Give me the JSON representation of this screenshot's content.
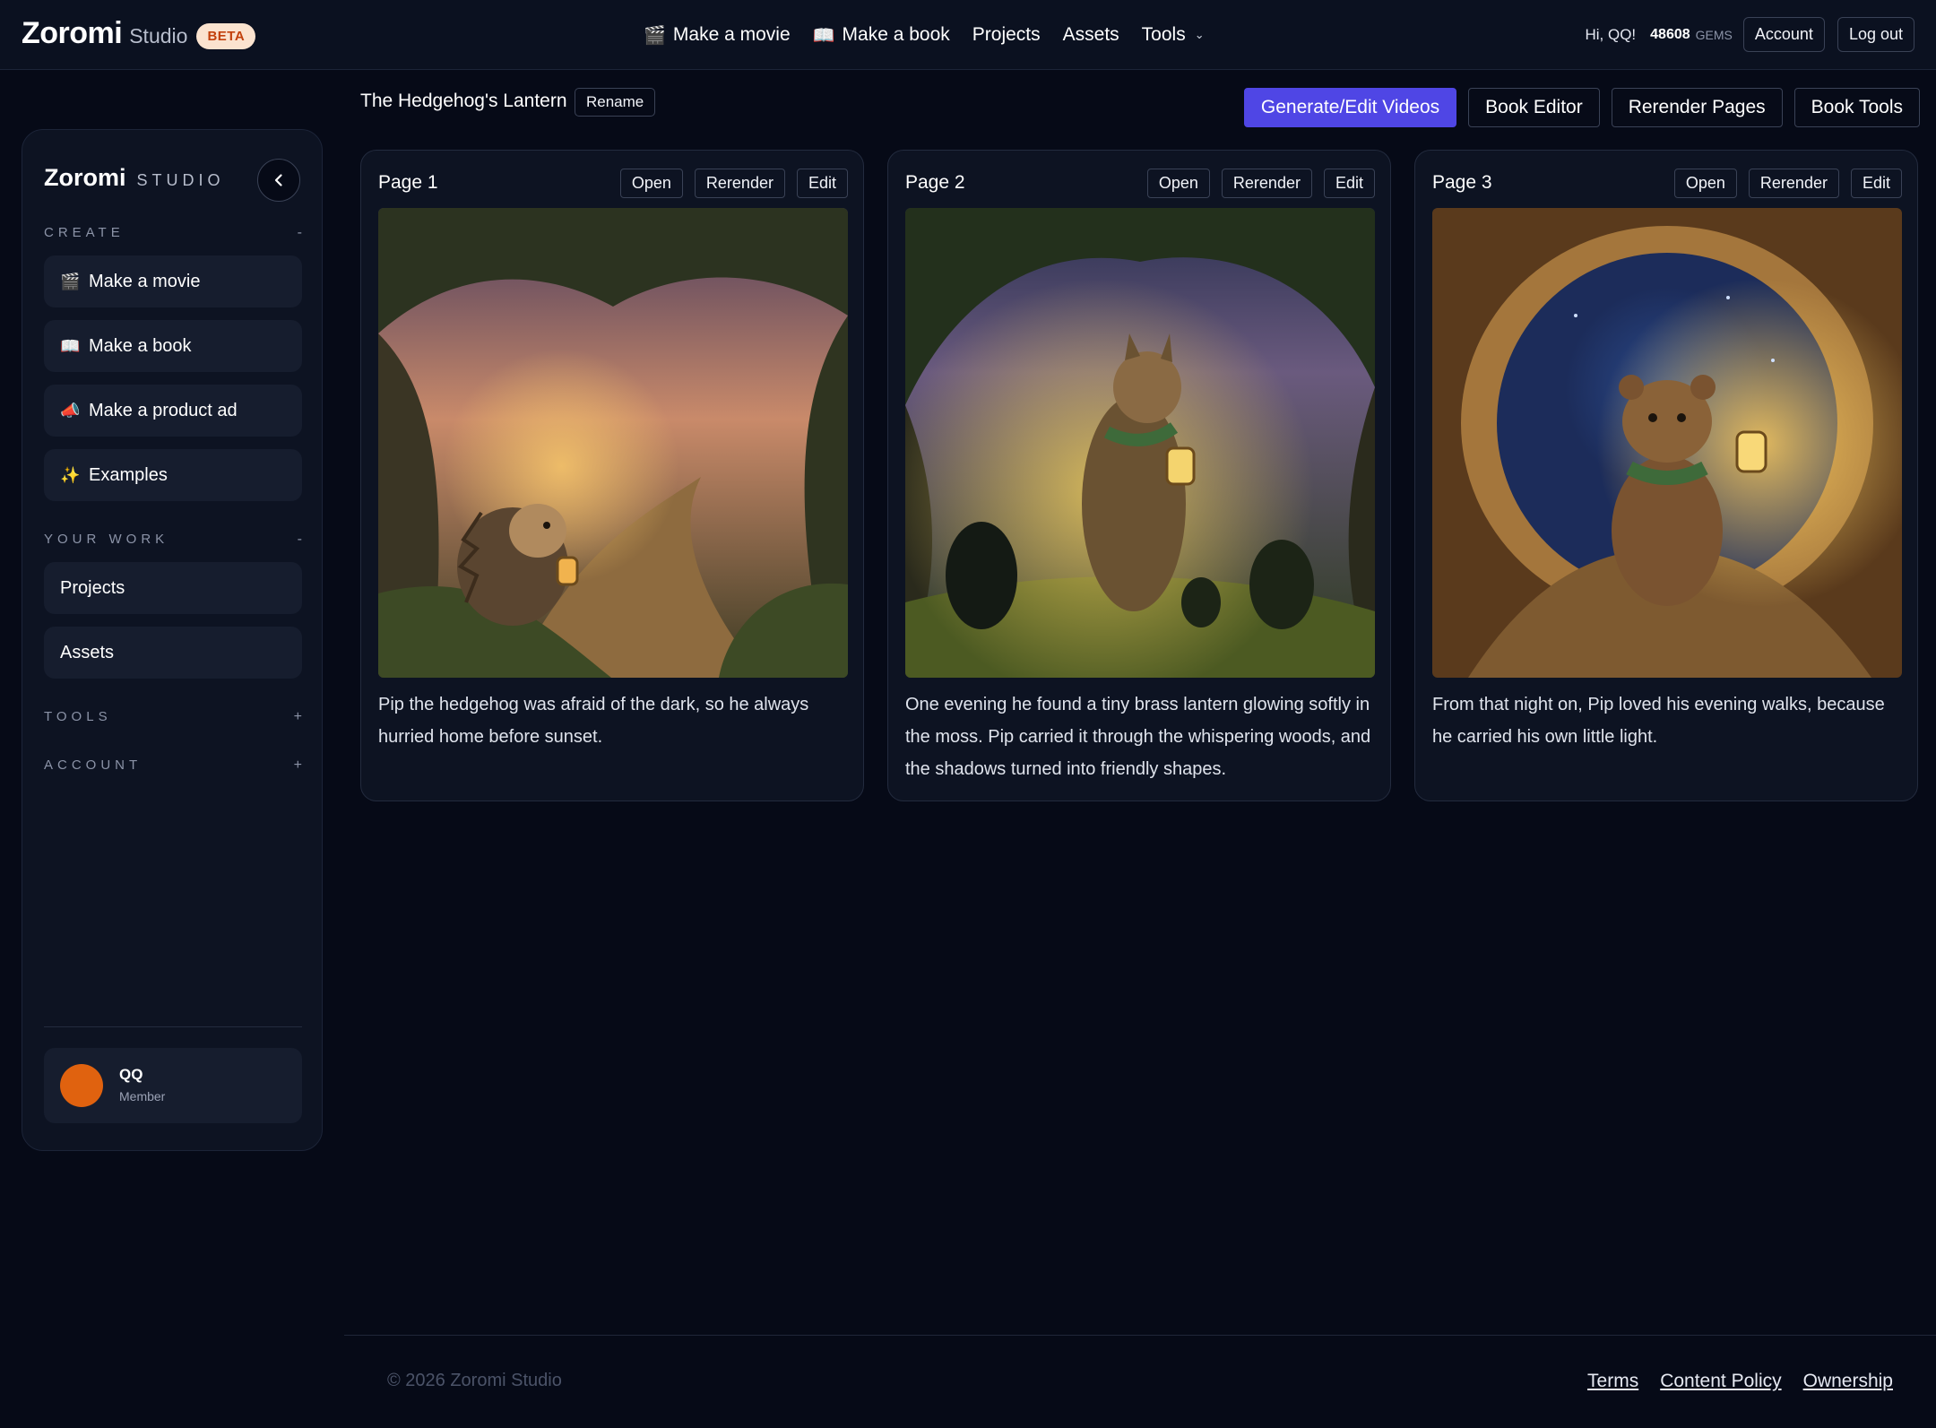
{
  "topnav": {
    "brand_name": "Zoromi",
    "brand_sub": "Studio",
    "badge": "BETA",
    "links": [
      {
        "icon": "🎬",
        "label": "Make a movie"
      },
      {
        "icon": "📖",
        "label": "Make a book"
      },
      {
        "label": "Projects"
      },
      {
        "label": "Assets"
      },
      {
        "label": "Tools"
      }
    ],
    "greeting": "Hi, QQ!",
    "gems_count": "48608",
    "gems_label": "GEMS",
    "account_label": "Account",
    "logout_label": "Log out"
  },
  "sidebar": {
    "brand_name": "Zoromi",
    "brand_sub": "STUDIO",
    "collapse_icon": "chevron-left-icon",
    "sections": {
      "create": {
        "label": "CREATE",
        "toggle": "-"
      },
      "your_work": {
        "label": "YOUR WORK",
        "toggle": "-"
      },
      "tools": {
        "label": "TOOLS",
        "toggle": "+"
      },
      "account": {
        "label": "ACCOUNT",
        "toggle": "+"
      }
    },
    "create_items": [
      {
        "icon": "🎬",
        "label": "Make a movie"
      },
      {
        "icon": "📖",
        "label": "Make a book"
      },
      {
        "icon": "📣",
        "label": "Make a product ad"
      },
      {
        "icon": "✨",
        "label": "Examples"
      }
    ],
    "work_items": [
      {
        "label": "Projects"
      },
      {
        "label": "Assets"
      }
    ],
    "user": {
      "name": "QQ",
      "role": "Member",
      "avatar_color": "#e0620f"
    }
  },
  "main": {
    "title": "The Hedgehog's Lantern",
    "rename_label": "Rename",
    "actions": [
      "Generate/Edit Videos",
      "Book Editor",
      "Rerender Pages",
      "Book Tools"
    ],
    "card_buttons": {
      "open": "Open",
      "rerender": "Rerender",
      "edit": "Edit"
    },
    "pages": [
      {
        "title": "Page 1",
        "text": "Pip the hedgehog was afraid of the dark, so he always hurried home before sunset."
      },
      {
        "title": "Page 2",
        "text": "One evening he found a tiny brass lantern glowing softly in the moss. Pip carried it through the whispering woods, and the shadows turned into friendly shapes."
      },
      {
        "title": "Page 3",
        "text": "From that night on, Pip loved his evening walks, because he carried his own little light."
      }
    ]
  },
  "footer": {
    "copyright": "© 2026 Zoromi Studio",
    "links": [
      "Terms",
      "Content Policy",
      "Ownership"
    ]
  },
  "colors": {
    "accent": "#4f46e5",
    "background": "#060a17",
    "card": "#0d1322",
    "badge_text": "#c2410c"
  }
}
